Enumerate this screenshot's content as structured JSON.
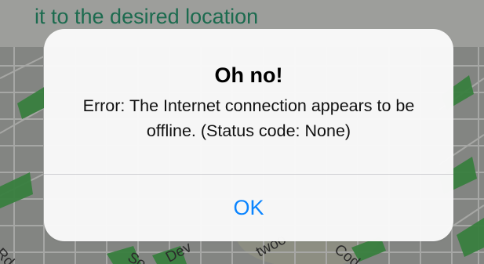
{
  "app": {
    "banner": {
      "instruction_text": "it to the desired location"
    },
    "alert": {
      "title": "Oh no!",
      "message": "Error: The Internet connection appears to be offline. (Status code: None)",
      "ok_label": "OK"
    },
    "map_labels": {
      "road_1": "Rd",
      "road_2": "So",
      "road_3": "Dev",
      "road_4": "twoo",
      "road_5": "Cod"
    }
  },
  "colors": {
    "instruction_text": "#1c6b4f",
    "alert_background": "#f8f8f8",
    "alert_button": "#0a84ff",
    "divider": "#d1d1d4"
  }
}
